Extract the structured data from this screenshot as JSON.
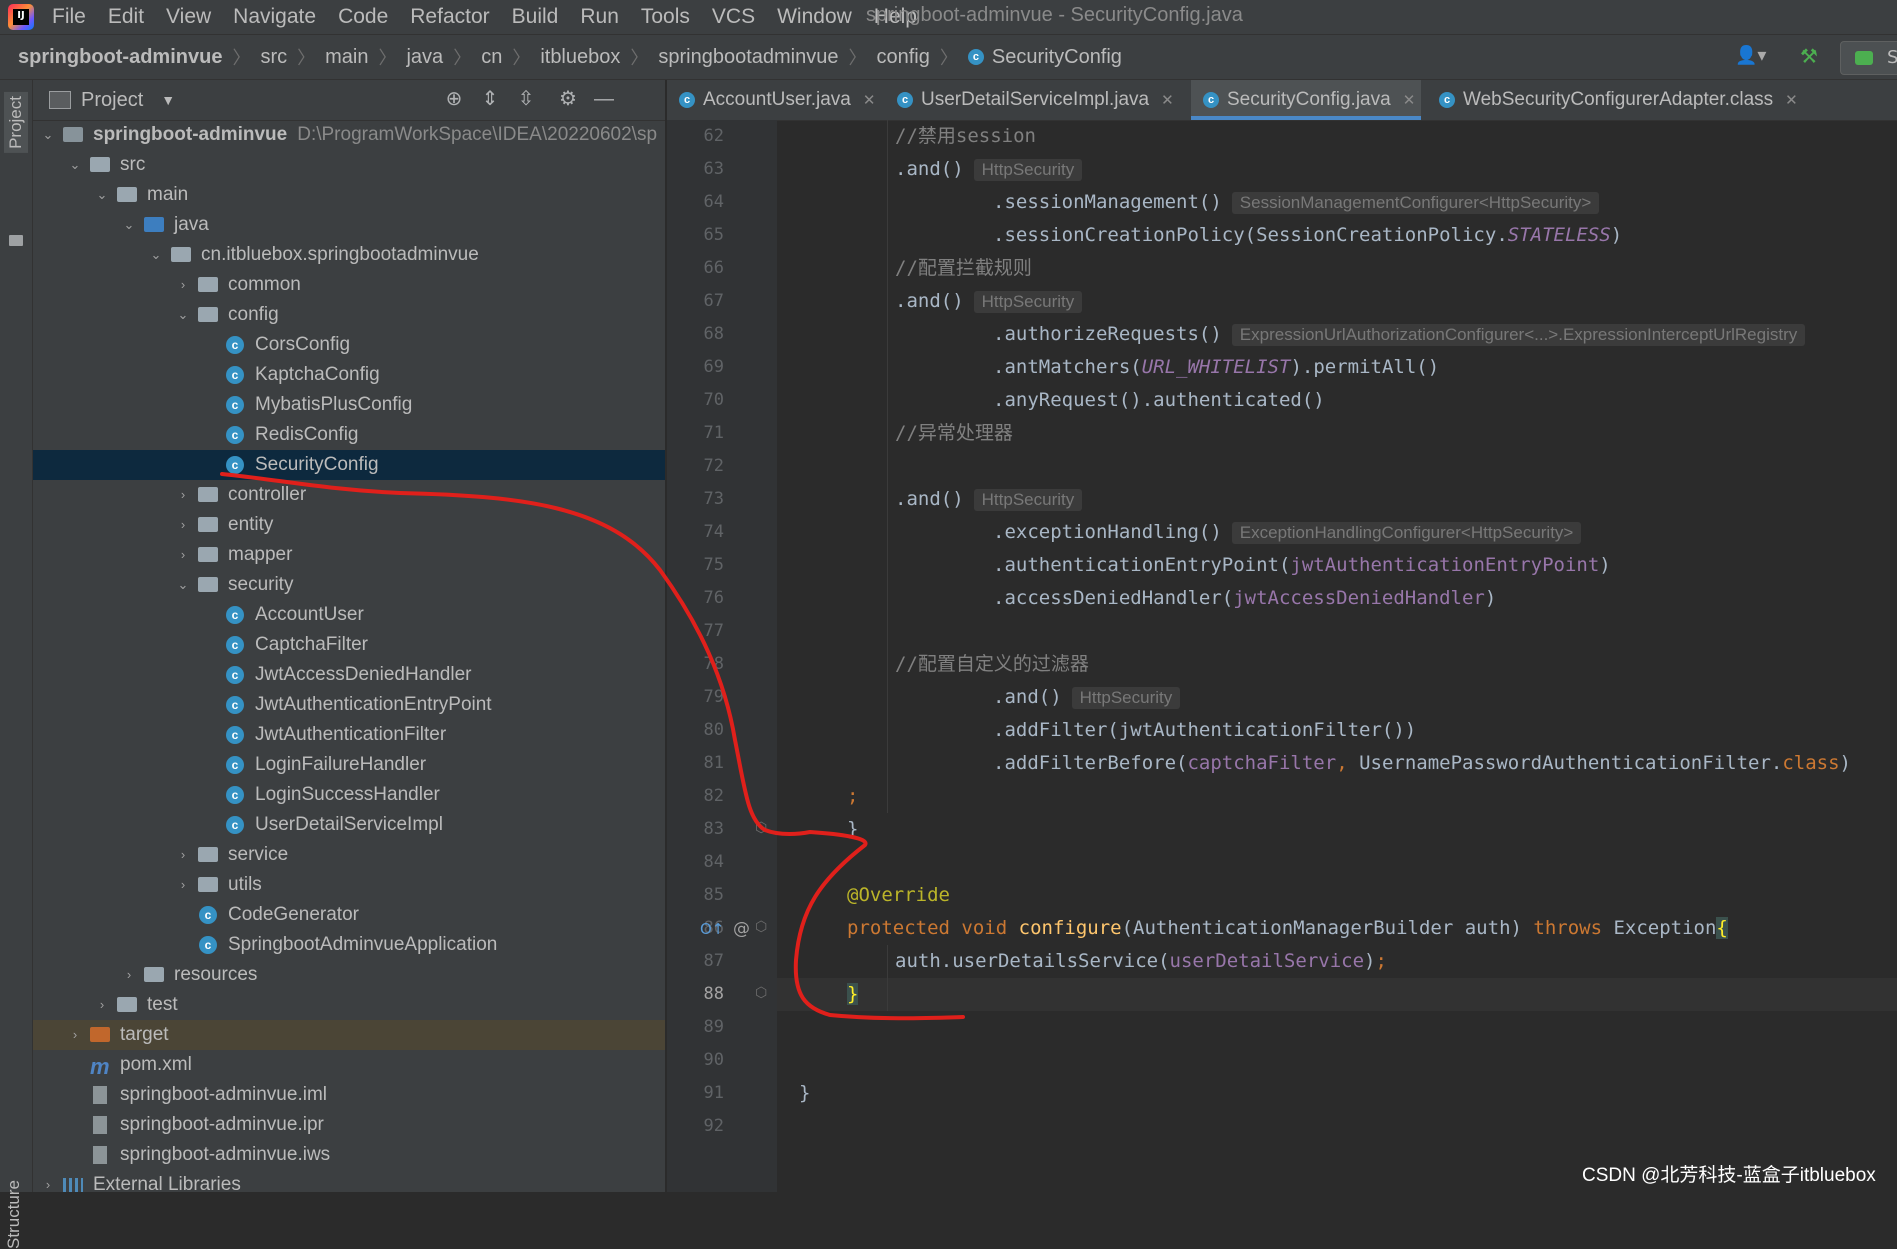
{
  "menu": [
    "File",
    "Edit",
    "View",
    "Navigate",
    "Code",
    "Refactor",
    "Build",
    "Run",
    "Tools",
    "VCS",
    "Window",
    "Help"
  ],
  "window_title": "springboot-adminvue - SecurityConfig.java",
  "breadcrumb": [
    "springboot-adminvue",
    "src",
    "main",
    "java",
    "cn",
    "itbluebox",
    "springbootadminvue",
    "config",
    "SecurityConfig"
  ],
  "run_config_label": "S",
  "tool_strip": {
    "project": "Project",
    "structure": "Structure"
  },
  "project_panel": {
    "title": "Project",
    "tree": [
      {
        "label": "springboot-adminvue",
        "path": "D:\\ProgramWorkSpace\\IDEA\\20220602\\sp"
      },
      {
        "label": "src"
      },
      {
        "label": "main"
      },
      {
        "label": "java"
      },
      {
        "label": "cn.itbluebox.springbootadminvue"
      },
      {
        "label": "common"
      },
      {
        "label": "config"
      },
      {
        "label": "CorsConfig"
      },
      {
        "label": "KaptchaConfig"
      },
      {
        "label": "MybatisPlusConfig"
      },
      {
        "label": "RedisConfig"
      },
      {
        "label": "SecurityConfig"
      },
      {
        "label": "controller"
      },
      {
        "label": "entity"
      },
      {
        "label": "mapper"
      },
      {
        "label": "security"
      },
      {
        "label": "AccountUser"
      },
      {
        "label": "CaptchaFilter"
      },
      {
        "label": "JwtAccessDeniedHandler"
      },
      {
        "label": "JwtAuthenticationEntryPoint"
      },
      {
        "label": "JwtAuthenticationFilter"
      },
      {
        "label": "LoginFailureHandler"
      },
      {
        "label": "LoginSuccessHandler"
      },
      {
        "label": "UserDetailServiceImpl"
      },
      {
        "label": "service"
      },
      {
        "label": "utils"
      },
      {
        "label": "CodeGenerator"
      },
      {
        "label": "SpringbootAdminvueApplication"
      },
      {
        "label": "resources"
      },
      {
        "label": "test"
      },
      {
        "label": "target"
      },
      {
        "label": "pom.xml"
      },
      {
        "label": "springboot-adminvue.iml"
      },
      {
        "label": "springboot-adminvue.ipr"
      },
      {
        "label": "springboot-adminvue.iws"
      },
      {
        "label": "External Libraries"
      }
    ]
  },
  "tabs": [
    {
      "label": "AccountUser.java",
      "close": "✕"
    },
    {
      "label": "UserDetailServiceImpl.java",
      "close": "✕"
    },
    {
      "label": "SecurityConfig.java",
      "close": "✕"
    },
    {
      "label": "WebSecurityConfigurerAdapter.class",
      "close": "✕"
    }
  ],
  "line_numbers": [
    "62",
    "63",
    "64",
    "65",
    "66",
    "67",
    "68",
    "69",
    "70",
    "71",
    "72",
    "73",
    "74",
    "75",
    "76",
    "77",
    "78",
    "79",
    "80",
    "81",
    "82",
    "83",
    "84",
    "85",
    "86",
    "87",
    "88",
    "89",
    "90",
    "91",
    "92"
  ],
  "code": {
    "l62": "//禁用session",
    "l63_a": ".and()",
    "l63_hint": "HttpSecurity",
    "l64_a": ".sessionManagement()",
    "l64_hint": "SessionManagementConfigurer<HttpSecurity>",
    "l65_a": ".sessionCreationPolicy(SessionCreationPolicy.",
    "l65_b": "STATELESS",
    "l65_c": ")",
    "l66": "//配置拦截规则",
    "l67_a": ".and()",
    "l67_hint": "HttpSecurity",
    "l68_a": ".authorizeRequests()",
    "l68_hint": "ExpressionUrlAuthorizationConfigurer<...>.ExpressionInterceptUrlRegistry",
    "l69_a": ".antMatchers(",
    "l69_b": "URL_WHITELIST",
    "l69_c": ").permitAll()",
    "l70": ".anyRequest().authenticated()",
    "l71": "//异常处理器",
    "l73_a": ".and()",
    "l73_hint": "HttpSecurity",
    "l74_a": ".exceptionHandling()",
    "l74_hint": "ExceptionHandlingConfigurer<HttpSecurity>",
    "l75_a": ".authenticationEntryPoint(",
    "l75_b": "jwtAuthenticationEntryPoint",
    "l75_c": ")",
    "l76_a": ".accessDeniedHandler(",
    "l76_b": "jwtAccessDeniedHandler",
    "l76_c": ")",
    "l78": "//配置自定义的过滤器",
    "l79_a": ".and()",
    "l79_hint": "HttpSecurity",
    "l80": ".addFilter(jwtAuthenticationFilter())",
    "l81_a": ".addFilterBefore(",
    "l81_b": "captchaFilter",
    "l81_c": ", ",
    "l81_d": "UsernamePasswordAuthenticationFilter.",
    "l81_e": "class",
    "l81_f": ")",
    "l82": ";",
    "l83": "}",
    "l85": "@Override",
    "l86_a": "protected",
    "l86_b": " ",
    "l86_c": "void",
    "l86_d": " ",
    "l86_e": "configure",
    "l86_f": "(AuthenticationManagerBuilder auth) ",
    "l86_g": "throws",
    "l86_h": " Exception",
    "l86_i": "{",
    "l87_a": "auth.userDetailsService(",
    "l87_b": "userDetailService",
    "l87_c": ")",
    "l87_d": ";",
    "l88": "}",
    "l91": "}"
  },
  "gutter_marks": {
    "override": "@",
    "implements": "O↑"
  },
  "watermark": "CSDN @北芳科技-蓝盒子itbluebox",
  "colors": {
    "annotation_red": "#e0201b",
    "selection": "#0d293e",
    "accent_tab": "#4a88c7"
  }
}
